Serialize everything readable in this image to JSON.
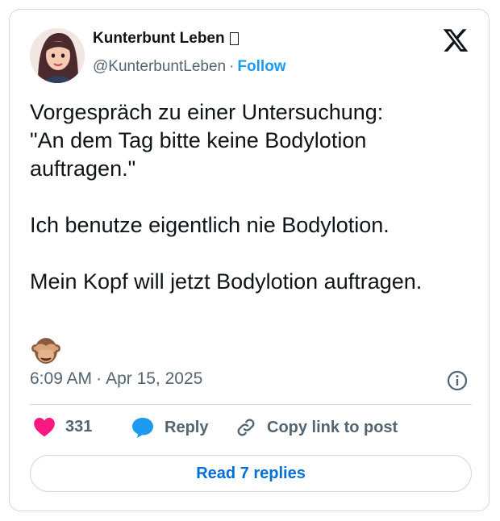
{
  "author": {
    "display_name": "Kunterbunt Leben",
    "handle": "@KunterbuntLeben",
    "separator": "·",
    "follow_label": "Follow"
  },
  "tweet": {
    "lines": [
      "Vorgespräch zu einer Untersuchung:",
      "\"An dem Tag bitte keine Bodylotion",
      "auftragen.\"",
      "",
      "Ich benutze eigentlich nie Bodylotion.",
      "",
      "Mein Kopf will jetzt Bodylotion auftragen."
    ],
    "emoji": "see-no-evil-monkey"
  },
  "meta": {
    "time": "6:09 AM",
    "separator": "·",
    "date": "Apr 15, 2025"
  },
  "actions": {
    "like_count": "331",
    "reply_label": "Reply",
    "copy_label": "Copy link to post"
  },
  "read_replies_label": "Read 7 replies",
  "icons": {
    "brand": "x-logo-icon",
    "info": "info-icon",
    "like": "heart-icon",
    "reply": "speech-bubble-icon",
    "copy": "link-icon"
  },
  "colors": {
    "text": "#0f1419",
    "secondary": "#536471",
    "accent": "#1d9bf0",
    "link": "#006fd6",
    "heart": "#f91880",
    "border": "#cfd9de"
  }
}
